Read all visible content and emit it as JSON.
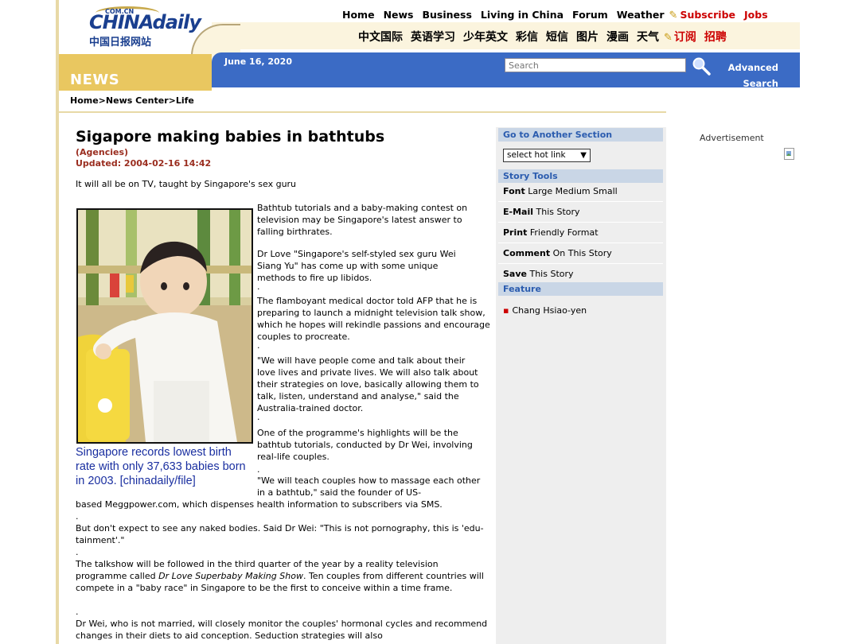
{
  "header": {
    "logo": {
      "com": "COM.CN",
      "brand": "CHINAdaily",
      "subtitle": "中国日报网站"
    },
    "nav_en": [
      "Home",
      "News",
      "Business",
      "Living in China",
      "Forum",
      "Weather"
    ],
    "nav_en_red": [
      "Subscribe",
      "Jobs"
    ],
    "nav_cn": [
      "中文国际",
      "英语学习",
      "少年英文",
      "彩信",
      "短信",
      "图片",
      "漫画",
      "天气"
    ],
    "nav_cn_red": [
      "订阅",
      "招聘"
    ],
    "section_label": "NEWS",
    "date": "June 16, 2020",
    "search_placeholder": "Search",
    "advanced_search": "Advanced Search",
    "breadcrumb": "Home>News Center>Life"
  },
  "article": {
    "headline": "Sigapore making babies in bathtubs",
    "agency": "(Agencies)",
    "updated": "Updated: 2004-02-16 14:42",
    "deck": "It will all be on TV, taught by Singapore's sex guru",
    "caption": "Singapore records lowest birth rate with only 37,633 babies born in 2003. [chinadaily/file]",
    "paragraphs": [
      "Bathtub tutorials and a baby-making contest on television may be Singapore's latest answer to falling birthrates.",
      "Dr Love \"Singapore's self-styled sex guru Wei Siang Yu\" has come up with some unique methods to fire up libidos.",
      "The flamboyant medical doctor told AFP that he is preparing to launch a midnight television talk show, which he hopes will rekindle passions and encourage couples to procreate.",
      "\"We will have people come and talk about their love lives and private lives. We will also talk about their strategies on love, basically allowing them to talk, listen, understand and analyse,\" said the Australia-trained doctor.",
      "One of the programme's highlights will be the bathtub tutorials, conducted by Dr Wei, involving real-life couples.",
      "\"We will teach couples how to massage each other in a bathtub,\" said the founder of US-",
      "based Meggpower.com, which dispenses health information to subscribers via SMS.",
      "But don't expect to see any naked bodies. Said Dr Wei: \"This is not pornography, this is 'edu-tainment'.\"",
      "The talkshow will be followed in the third quarter of the year by a reality television programme called ",
      "Dr Love Superbaby Making Show",
      ". Ten couples from different countries will compete in a \"baby race\" in Singapore to be the first to conceive within a time frame.",
      "Dr Wei, who is not married, will closely monitor the couples' hormonal cycles and recommend changes in their diets to aid conception. Seduction strategies will also"
    ],
    "separator": "."
  },
  "sidebar": {
    "go_section_title": "Go to Another Section",
    "hot_link": "select hot link",
    "story_tools_title": "Story Tools",
    "tools": [
      {
        "bold": "Font",
        "rest": "Large Medium Small"
      },
      {
        "bold": "E-Mail",
        "rest": "This Story"
      },
      {
        "bold": "Print",
        "rest": "Friendly Format"
      },
      {
        "bold": "Comment",
        "rest": "On This Story"
      },
      {
        "bold": "Save",
        "rest": "This Story"
      }
    ],
    "feature_title": "Feature",
    "feature_item": "Chang Hsiao-yen"
  },
  "ad": {
    "label": "Advertisement"
  },
  "colors": {
    "accent_blue": "#3b6bc5",
    "gold": "#e9c760",
    "headline_red": "#9a2d1f",
    "caption_blue": "#1a2fa0"
  }
}
